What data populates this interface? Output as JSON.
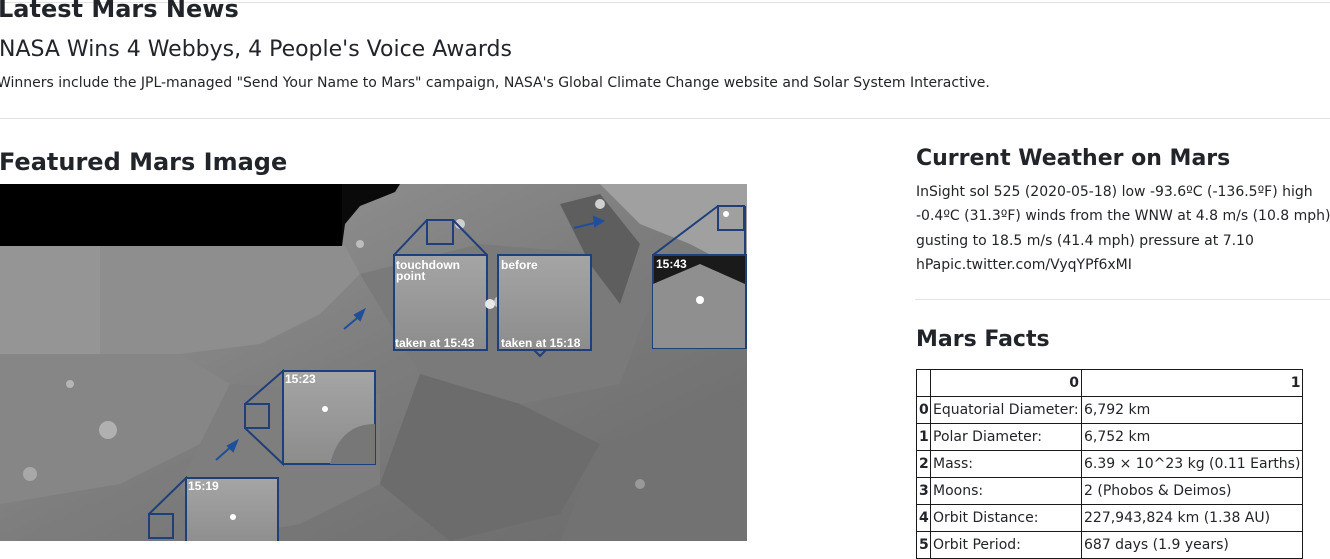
{
  "news": {
    "section_title": "Latest Mars News",
    "headline": "NASA Wins 4 Webbys, 4 People's Voice Awards",
    "teaser": "Winners include the JPL-managed \"Send Your Name to Mars\" campaign, NASA's Global Climate Change website and Solar System Interactive."
  },
  "featured": {
    "section_title": "Featured Mars Image",
    "image_labels": {
      "touchdown_line1": "touchdown",
      "touchdown_line2": "point",
      "touchdown_taken": "taken at 15:43",
      "before": "before",
      "before_taken": "taken at 15:18",
      "t1543": "15:43",
      "t1523": "15:23",
      "t1519": "15:19"
    }
  },
  "weather": {
    "section_title": "Current Weather on Mars",
    "text": "InSight sol 525 (2020-05-18) low -93.6ºC (-136.5ºF) high -0.4ºC (31.3ºF) winds from the WNW at 4.8 m/s (10.8 mph) gusting to 18.5 m/s (41.4 mph) pressure at 7.10 hPapic.twitter.com/VyqYPf6xMI"
  },
  "facts": {
    "section_title": "Mars Facts",
    "columns": [
      "",
      "0",
      "1"
    ],
    "rows": [
      {
        "index": "0",
        "label": "Equatorial Diameter:",
        "value": "6,792 km"
      },
      {
        "index": "1",
        "label": "Polar Diameter:",
        "value": "6,752 km"
      },
      {
        "index": "2",
        "label": "Mass:",
        "value": "6.39 × 10^23 kg (0.11 Earths)"
      },
      {
        "index": "3",
        "label": "Moons:",
        "value": "2 (Phobos & Deimos)"
      },
      {
        "index": "4",
        "label": "Orbit Distance:",
        "value": "227,943,824 km (1.38 AU)"
      },
      {
        "index": "5",
        "label": "Orbit Period:",
        "value": "687 days (1.9 years)"
      }
    ]
  }
}
